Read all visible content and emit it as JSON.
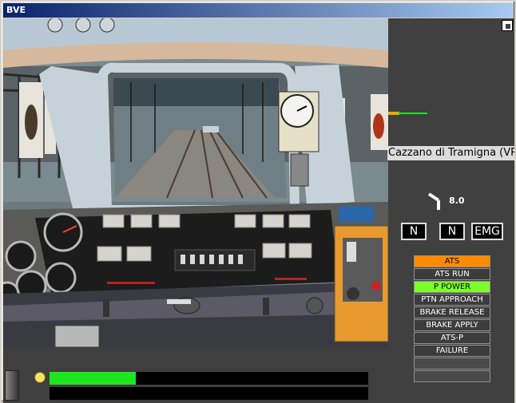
{
  "window": {
    "title": "BVE"
  },
  "station": {
    "name": "Cazzano di Tramigna (VR"
  },
  "speed": {
    "value": "8.0"
  },
  "indicators": [
    {
      "label": "N",
      "name": "reverser-indicator"
    },
    {
      "label": "N",
      "name": "power-indicator"
    },
    {
      "label": "EMG",
      "name": "brake-indicator"
    }
  ],
  "ats_panel": {
    "items": [
      {
        "label": "ATS",
        "state": "orange"
      },
      {
        "label": "ATS RUN",
        "state": "off"
      },
      {
        "label": "P POWER",
        "state": "green"
      },
      {
        "label": "PTN APPROACH",
        "state": "off"
      },
      {
        "label": "BRAKE RELEASE",
        "state": "off"
      },
      {
        "label": "BRAKE APPLY",
        "state": "off"
      },
      {
        "label": "ATS-P",
        "state": "off"
      },
      {
        "label": "FAILURE",
        "state": "off"
      },
      {
        "label": "",
        "state": "empty"
      },
      {
        "label": "",
        "state": "empty"
      }
    ]
  },
  "status": {
    "score_fraction": 0.27
  },
  "colors": {
    "signal_green": "#2cdc2c",
    "ats_orange": "#ff8c00",
    "ats_green": "#7cff2a",
    "bar_green": "#1ee61e"
  }
}
